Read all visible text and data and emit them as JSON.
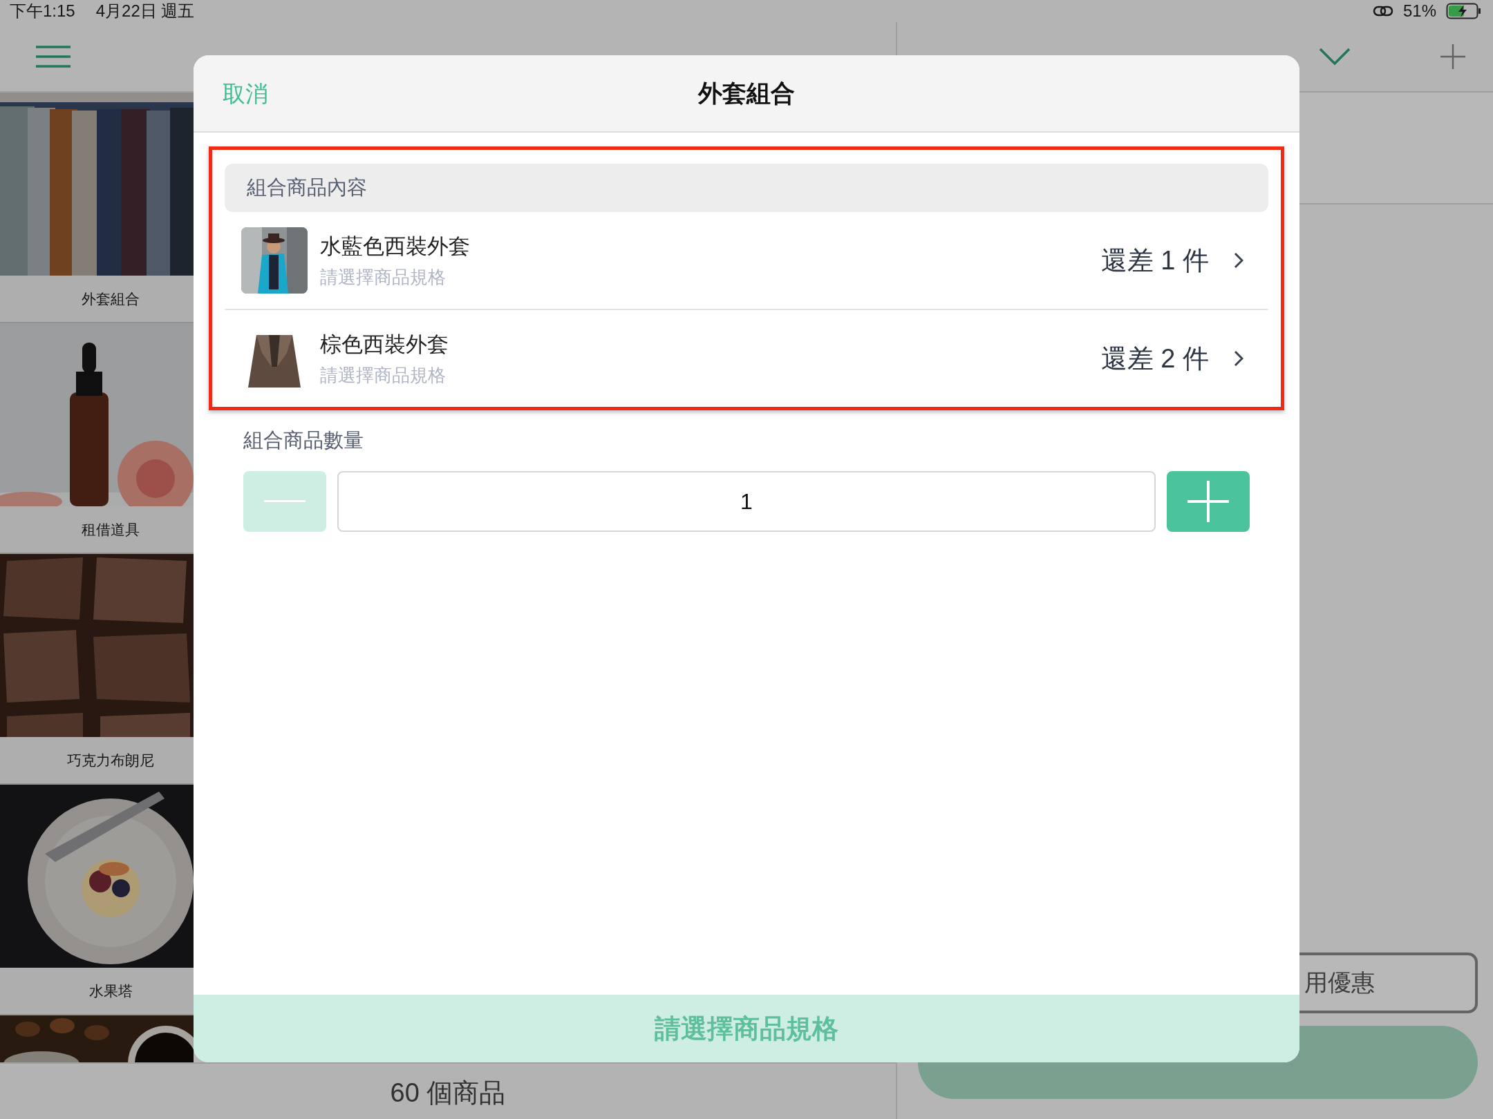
{
  "status_bar": {
    "time": "下午1:15",
    "date": "4月22日 週五",
    "battery": "51%"
  },
  "products": [
    {
      "kind": "picture",
      "name": "外套組合"
    },
    {
      "kind": "picture",
      "name": "租借道具"
    },
    {
      "kind": "picture",
      "name": "巧克力布朗尼"
    },
    {
      "kind": "picture",
      "name": "水果塔"
    },
    {
      "kind": "picture"
    }
  ],
  "product_count": "60 個商品",
  "coupon_button": "用優惠",
  "modal": {
    "cancel": "取消",
    "title": "外套組合",
    "section_title": "組合商品內容",
    "items": [
      {
        "kind": "picture",
        "name": "水藍色西裝外套",
        "hint": "請選擇商品規格",
        "remaining": "還差 1 件"
      },
      {
        "kind": "picture",
        "name": "棕色西裝外套",
        "hint": "請選擇商品規格",
        "remaining": "還差 2 件"
      }
    ],
    "quantity_label": "組合商品數量",
    "quantity": "1",
    "minus_disabled": true,
    "plus_disabled": false,
    "submit": "請選擇商品規格",
    "submit_disabled": true
  }
}
